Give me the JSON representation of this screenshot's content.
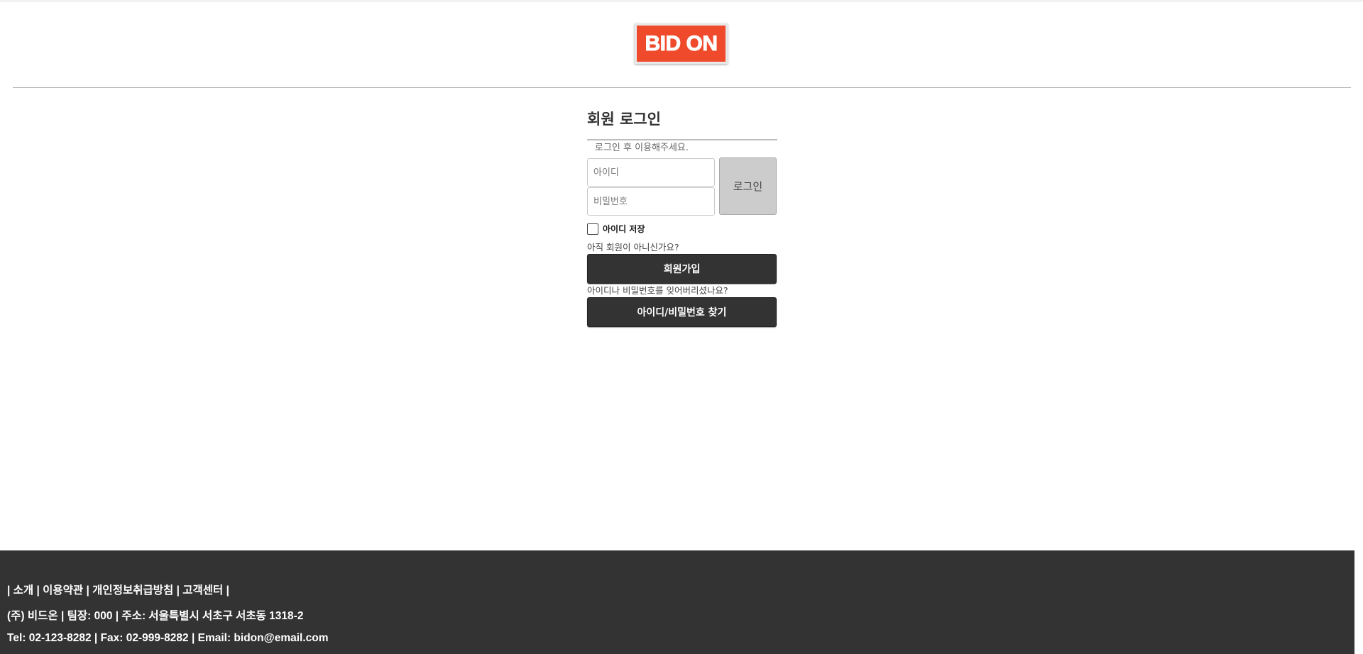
{
  "header": {
    "logo_text": "BID ON",
    "logo_color": "#f04a2c"
  },
  "login": {
    "title": "회원 로그인",
    "notice": "로그인 후 이용해주세요.",
    "id_placeholder": "아이디",
    "pw_placeholder": "비밀번호",
    "login_button": "로그인",
    "remember_label": "아이디 저장",
    "signup_hint": "아직 회원이 아니신가요?",
    "signup_button": "회원가입",
    "find_hint": "아이디나 비밀번호를 잊어버리셨나요?",
    "find_button": "아이디/비밀번호 찾기"
  },
  "footer": {
    "links": {
      "sep": "|",
      "about": "소개",
      "terms": "이용약관",
      "privacy": "개인정보취급방침",
      "support": "고객센터"
    },
    "company_line": "(주) 비드온 | 팀장: 000 | 주소: 서울특별시 서초구 서초동 1318-2",
    "contact_line": "Tel: 02-123-8282 | Fax: 02-999-8282 | Email: bidon@email.com",
    "background_color": "#333333"
  }
}
